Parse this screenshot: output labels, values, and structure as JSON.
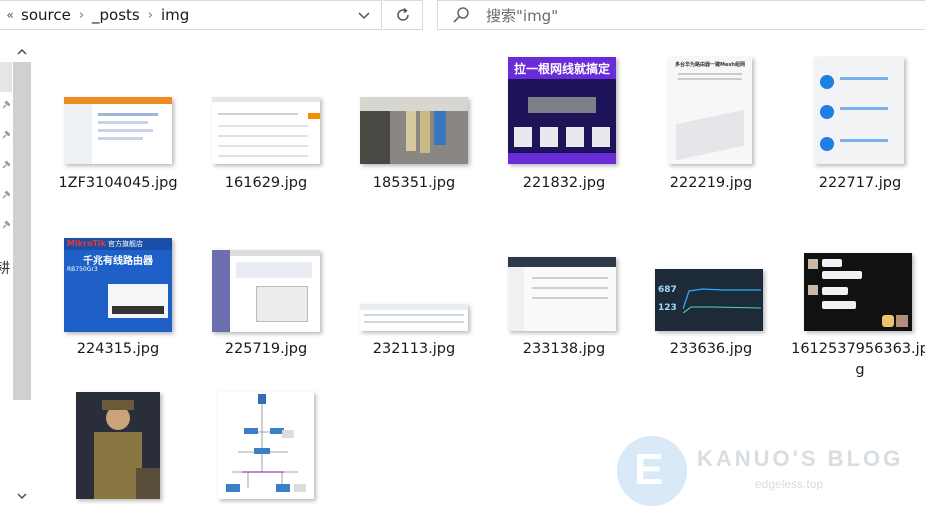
{
  "address": {
    "overflow": "«",
    "crumbs": [
      "source",
      "_posts",
      "img"
    ]
  },
  "search": {
    "placeholder": "搜索\"img\""
  },
  "nav_pane": {
    "partial_char": "耕"
  },
  "files": [
    {
      "name": "1ZF3104045.jpg",
      "icon": "image-thumbnail"
    },
    {
      "name": "161629.jpg",
      "icon": "image-thumbnail"
    },
    {
      "name": "185351.jpg",
      "icon": "image-thumbnail"
    },
    {
      "name": "221832.jpg",
      "icon": "image-thumbnail"
    },
    {
      "name": "222219.jpg",
      "icon": "image-thumbnail"
    },
    {
      "name": "222717.jpg",
      "icon": "image-thumbnail"
    },
    {
      "name": "224315.jpg",
      "icon": "image-thumbnail"
    },
    {
      "name": "225719.jpg",
      "icon": "image-thumbnail"
    },
    {
      "name": "232113.jpg",
      "icon": "image-thumbnail"
    },
    {
      "name": "233138.jpg",
      "icon": "image-thumbnail"
    },
    {
      "name": "233636.jpg",
      "icon": "image-thumbnail"
    },
    {
      "name": "1612537956363.jpg",
      "icon": "image-thumbnail"
    },
    {
      "name": "",
      "icon": "image-thumbnail"
    },
    {
      "name": "",
      "icon": "image-thumbnail"
    }
  ],
  "thumb_text": {
    "t4_banner": "拉一根网线就搞定",
    "t5_title": "多台华为路由器一键Mesh组网",
    "t7_brand": "MikroTik",
    "t7_store": "官方旗舰店",
    "t7_title": "千兆有线路由器",
    "t7_model": "RB750Gr3",
    "t11_down": "687",
    "t11_up": "123"
  },
  "watermark": {
    "letter": "E",
    "title": "KANUO'S BLOG",
    "url": "edgeless.top"
  }
}
